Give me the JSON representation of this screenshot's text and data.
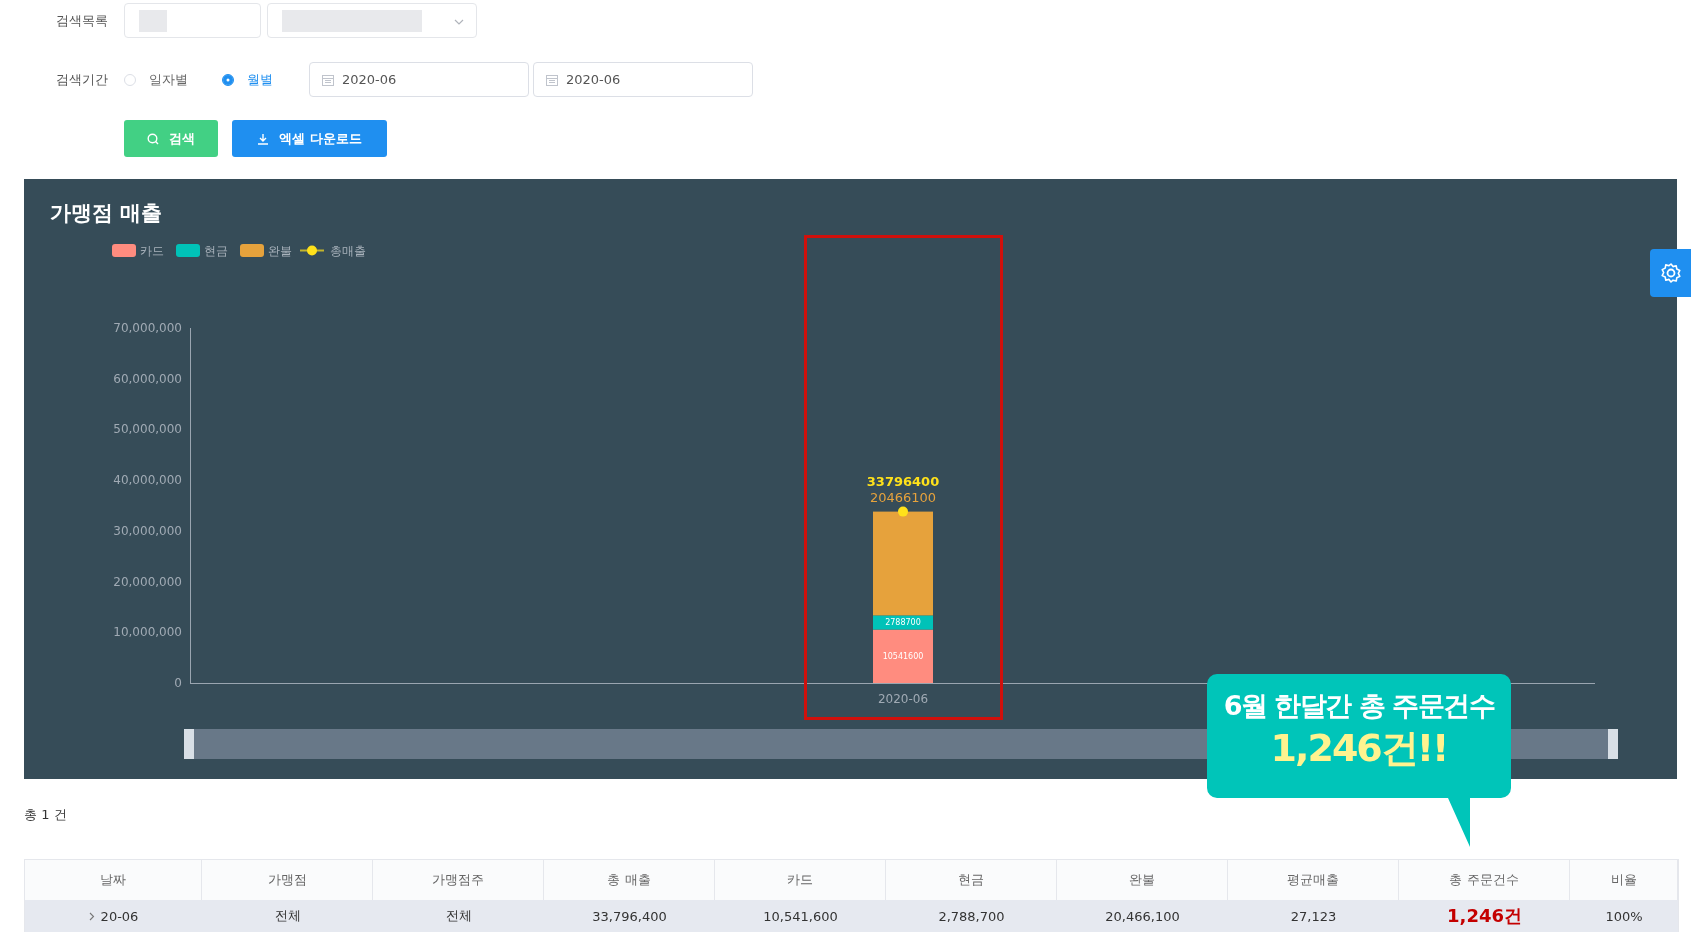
{
  "search_form": {
    "category_label": "검색목록",
    "period_label": "검색기간",
    "period_options": [
      {
        "label": "일자별",
        "selected": false
      },
      {
        "label": "월별",
        "selected": true
      }
    ],
    "date_from": "2020-06",
    "date_to": "2020-06",
    "buttons": [
      {
        "kind": "search",
        "label": "검색"
      },
      {
        "kind": "download",
        "label": "엑셀 다운로드"
      }
    ]
  },
  "chart": {
    "title": "가맹점 매출",
    "chart_data": {
      "type": "bar",
      "stacked": true,
      "categories": [
        "2020-06"
      ],
      "ylim": [
        0,
        70000000
      ],
      "yticks": [
        {
          "value": 0,
          "label": "0"
        },
        {
          "value": 10000000,
          "label": "10,000,000"
        },
        {
          "value": 20000000,
          "label": "20,000,000"
        },
        {
          "value": 30000000,
          "label": "30,000,000"
        },
        {
          "value": 40000000,
          "label": "40,000,000"
        },
        {
          "value": 50000000,
          "label": "50,000,000"
        },
        {
          "value": 60000000,
          "label": "60,000,000"
        },
        {
          "value": 70000000,
          "label": "70,000,000"
        }
      ],
      "series": [
        {
          "name": "카드",
          "type": "bar",
          "color": "#ff8c7f",
          "values": [
            10541600
          ]
        },
        {
          "name": "현금",
          "type": "bar",
          "color": "#00c2b8",
          "values": [
            2788700
          ]
        },
        {
          "name": "완불",
          "type": "bar",
          "color": "#e6a23c",
          "values": [
            20466100
          ]
        },
        {
          "name": "총매출",
          "type": "line",
          "marker": "circle",
          "color": "#ffe11a",
          "values": [
            33796400
          ]
        }
      ],
      "legend": "top",
      "data_labels": true
    },
    "zoom_slider": {
      "level": 1
    }
  },
  "callout": {
    "headline": "6월 한달간 총 주문건수",
    "count": "1,246건!!"
  },
  "total_count": "총 1 건",
  "table": {
    "columns": [
      "날짜",
      "가맹점",
      "가맹점주",
      "총 매출",
      "카드",
      "현금",
      "완불",
      "평균매출",
      "총 주문건수",
      "비율"
    ],
    "rows": [
      {
        "expanded": false,
        "cells": [
          "20-06",
          "전체",
          "전체",
          "33,796,400",
          "10,541,600",
          "2,788,700",
          "20,466,100",
          "27,123",
          "1,246건",
          "100%"
        ]
      }
    ]
  }
}
